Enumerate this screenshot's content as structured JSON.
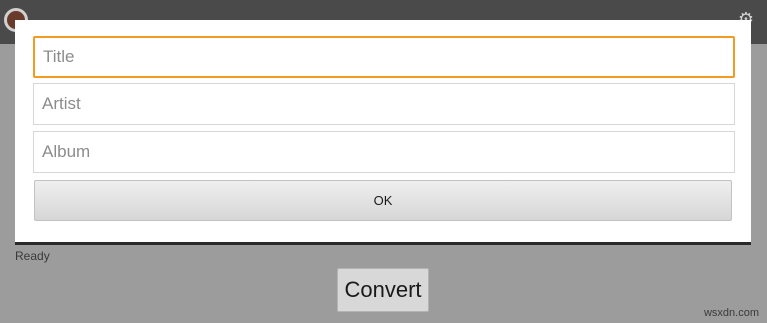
{
  "background": {
    "status": "Ready",
    "convert_label": "Convert",
    "watermark": "wsxdn.com"
  },
  "dialog": {
    "title_placeholder": "Title",
    "artist_placeholder": "Artist",
    "album_placeholder": "Album",
    "ok_label": "OK",
    "focus_color": "#f29a22"
  },
  "icons": {
    "app": "app-logo-icon",
    "settings": "gear-icon"
  }
}
